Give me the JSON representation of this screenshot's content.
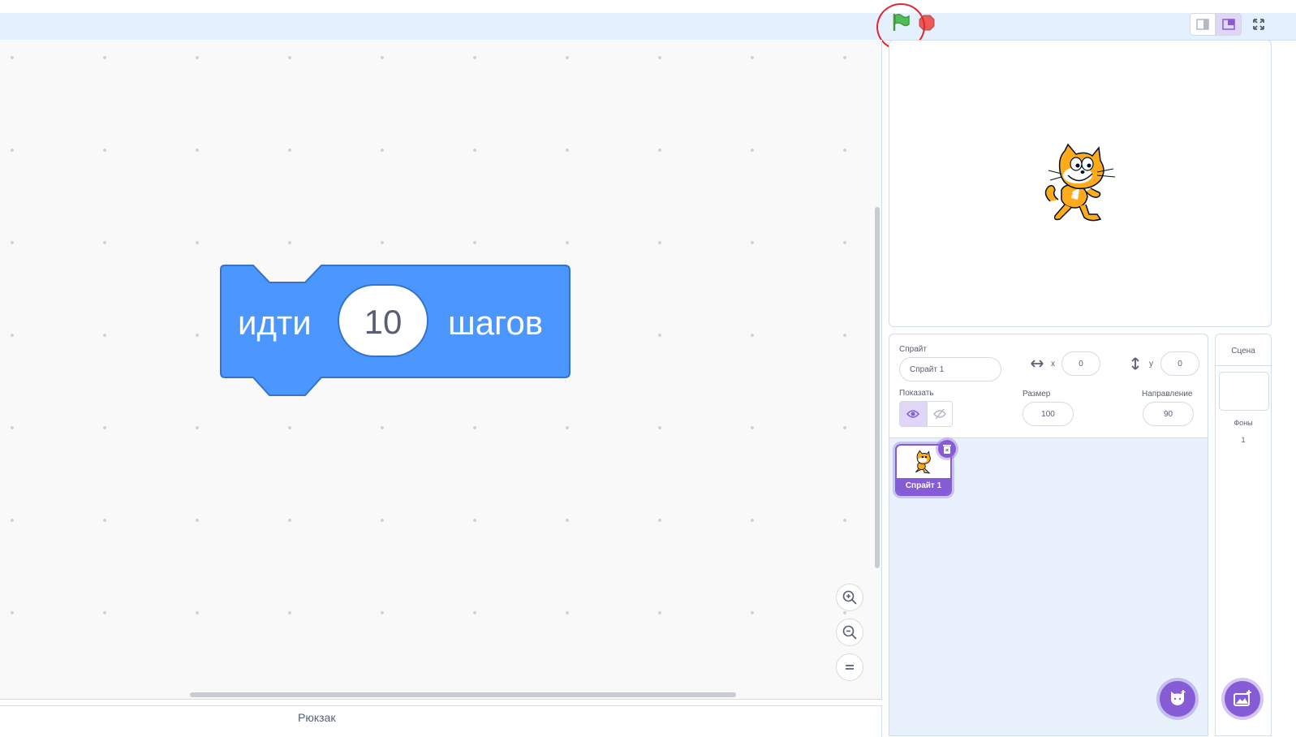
{
  "toolbar": {
    "green_flag_icon": "green-flag-icon",
    "stop_icon": "stop-icon"
  },
  "workspace": {
    "block": {
      "label_before": "идти",
      "steps_value": "10",
      "label_after": "шагов",
      "color": "#4c97ff"
    }
  },
  "backpack": {
    "label": "Рюкзак"
  },
  "sprite_info": {
    "sprite_label": "Спрайт",
    "sprite_name": "Спрайт 1",
    "x_label": "x",
    "x_value": "0",
    "y_label": "y",
    "y_value": "0",
    "show_label": "Показать",
    "size_label": "Размер",
    "size_value": "100",
    "direction_label": "Направление",
    "direction_value": "90"
  },
  "sprite_list": [
    {
      "name": "Спрайт 1",
      "selected": true
    }
  ],
  "scene": {
    "title": "Сцена",
    "backdrops_label": "Фоны",
    "backdrops_count": "1"
  },
  "colors": {
    "accent": "#855cd6",
    "block_border": "#3373cc",
    "highlight_circle": "#e3242b"
  }
}
